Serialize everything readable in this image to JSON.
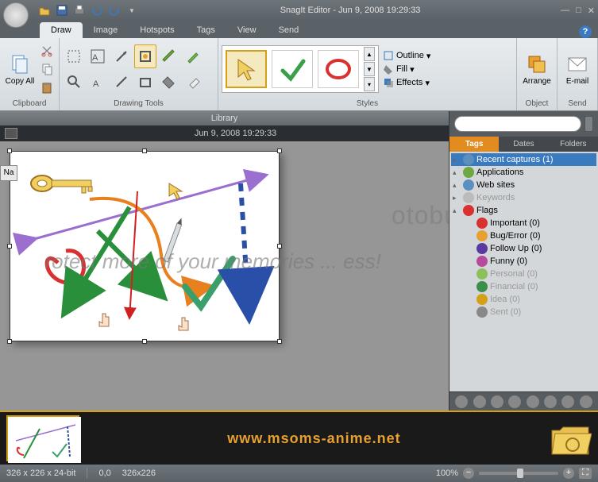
{
  "title": "SnagIt Editor - Jun 9, 2008 19:29:33",
  "tabs": [
    "Draw",
    "Image",
    "Hotspots",
    "Tags",
    "View",
    "Send"
  ],
  "ribbon": {
    "clipboard": {
      "label": "Clipboard",
      "copy_all": "Copy All"
    },
    "drawing": {
      "label": "Drawing Tools"
    },
    "styles": {
      "label": "Styles",
      "outline": "Outline",
      "fill": "Fill",
      "effects": "Effects"
    },
    "object": {
      "label": "Object",
      "arrange": "Arrange"
    },
    "send": {
      "label": "Send",
      "email": "E-mail"
    }
  },
  "library_label": "Library",
  "capture_title": "Jun 9, 2008 19:29:33",
  "name_tab": "Na",
  "panel_tabs": [
    "Tags",
    "Dates",
    "Folders"
  ],
  "tree": {
    "recent": "Recent captures (1)",
    "applications": "Applications",
    "websites": "Web sites",
    "keywords": "Keywords",
    "flags": "Flags",
    "flag_items": [
      {
        "label": "Important (0)",
        "color": "#d93030"
      },
      {
        "label": "Bug/Error (0)",
        "color": "#e8a030"
      },
      {
        "label": "Follow Up (0)",
        "color": "#5a3aa0"
      },
      {
        "label": "Funny (0)",
        "color": "#b84a9e"
      },
      {
        "label": "Personal (0)",
        "color": "#8dc05a",
        "dim": true
      },
      {
        "label": "Financial (0)",
        "color": "#3a8f4a",
        "dim": true
      },
      {
        "label": "Idea (0)",
        "color": "#d4a017",
        "dim": true
      },
      {
        "label": "Sent (0)",
        "color": "#888",
        "dim": true
      }
    ]
  },
  "watermark_bg": "otobuc",
  "watermark_text": "rotect more of your memories ... ess!",
  "watermark_url": "www.msoms-anime.net",
  "status": {
    "dims": "326 x 226 x 24-bit",
    "pos": "0,0",
    "size": "326x226",
    "zoom": "100%"
  }
}
